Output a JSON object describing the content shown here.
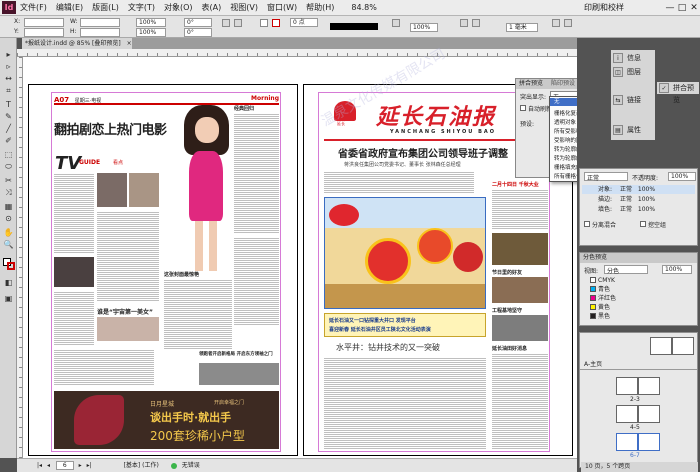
{
  "app": {
    "logo": "Id",
    "menus": [
      "文件(F)",
      "编辑(E)",
      "版面(L)",
      "文字(T)",
      "对象(O)",
      "表(A)",
      "视图(V)",
      "窗口(W)",
      "帮助(H)"
    ],
    "zoom": "84.8%",
    "workspace": "印刷和校样",
    "win_min": "—",
    "win_max": "□",
    "win_close": "✕"
  },
  "control": {
    "x_label": "X:",
    "y_label": "Y:",
    "w_label": "W:",
    "h_label": "H:",
    "x_value": "",
    "y_value": "",
    "w_value": "",
    "h_value": "",
    "pct1": "100%",
    "pct2": "100%",
    "stroke": "0 点",
    "deg1": "0°",
    "deg2": "0°",
    "frame_size": "1 毫米"
  },
  "document": {
    "tab_label": "*报纸设计.indd @ 85% [叠印预览]",
    "tab_close": "×"
  },
  "tools": [
    "▸",
    "▹",
    "↔",
    "⌗",
    "T",
    "✎",
    "╱",
    "✐",
    "⬚",
    "⬭",
    "✂",
    "⤨",
    "▦",
    "⊙",
    "✋",
    "🔍",
    "◧",
    "▣"
  ],
  "left_page": {
    "folio": "A07",
    "section": "星期三·电视",
    "masthead_right": "Morning",
    "headline": "翻拍剧恋上热门电影",
    "tv_logo": "TV",
    "guide": "GUIDE",
    "tag": "看点",
    "sub1": "经典回归",
    "sub2": "这张封面最惊艳",
    "mid_title": "谁是“宇宙第一美女”",
    "ad_line1": "谈出手时·就出手",
    "ad_line2": "200套珍稀小户型",
    "ad_brand": "日月星城",
    "ad_small": "开启幸福之门",
    "car_title": "领跑者开启新格局 开启东方领袖之门"
  },
  "right_page": {
    "masthead": "延长石油报",
    "logo_text": "延长",
    "pinyin": "YANCHANG SHIYOU BAO",
    "headline": "省委省政府宣布集团公司领导班子调整",
    "subhead": "蒋洪良任集团公司党委书记、董事长 张林森任总经理",
    "photo_caption1": "延长石油又一口钻探重大井口 发现平台",
    "photo_caption2": "喜迎新春 延长石油井区员工陕北文化活动表演",
    "lower_headline": "水平井：钻井技术的又一突破",
    "side_title": "二月十四日 千秋大业",
    "side_title2": "节日里的好友",
    "side_title3": "工程基地坚守",
    "side_title4": "延长油田好消息"
  },
  "watermark": "温泉文化传媒有限公司",
  "statusbar": {
    "page_num": "6",
    "preset": "[基本] (工作)",
    "preflight": "无错误"
  },
  "dock": {
    "buttons": [
      {
        "icon": "i",
        "label": "信息"
      },
      {
        "icon": "◫",
        "label": "图层"
      },
      {
        "icon": "✓",
        "label": "拼合预览"
      },
      {
        "icon": "⇆",
        "label": "链接"
      },
      {
        "icon": "▤",
        "label": "属性"
      }
    ],
    "flatten": {
      "title": "拼合预览",
      "tab2": "陷印预设",
      "highlight_label": "突出显示:",
      "highlight_value": "无",
      "auto_refresh": "自动刷新",
      "refresh_btn": "刷新",
      "preset_label": "预设:"
    },
    "dropdown": [
      "无",
      "栅格化复杂区域",
      "透明对象",
      "所有受影响的对象",
      "受影响的图形",
      "转为轮廓的描边",
      "转为轮廓的文本",
      "栅格填充的文本和描边",
      "所有栅格化区域"
    ],
    "opacity_panel": {
      "blend": "正常",
      "opacity_label": "不透明度:",
      "opacity": "100%",
      "rows": [
        {
          "label": "对象:",
          "mode": "正常",
          "value": "100%"
        },
        {
          "label": "描边:",
          "mode": "正常",
          "value": "100%"
        },
        {
          "label": "填色:",
          "mode": "正常",
          "value": "100%"
        }
      ],
      "isolate": "分离混合",
      "knockout": "挖空组"
    },
    "separations": {
      "title": "分色预览",
      "view_label": "视图:",
      "view_value": "分色",
      "pct": "100%",
      "inks": [
        {
          "name": "CMYK",
          "color": "#ffffff"
        },
        {
          "name": "青色",
          "color": "#00aeef"
        },
        {
          "name": "洋红色",
          "color": "#ec008c"
        },
        {
          "name": "黄色",
          "color": "#fff200"
        },
        {
          "name": "黑色",
          "color": "#231f20"
        }
      ]
    },
    "pages": {
      "master": "A-主页",
      "spread1": "2-3",
      "spread2": "4-5",
      "spread3": "6-7",
      "footer": "10 页，5 个跨页"
    }
  }
}
